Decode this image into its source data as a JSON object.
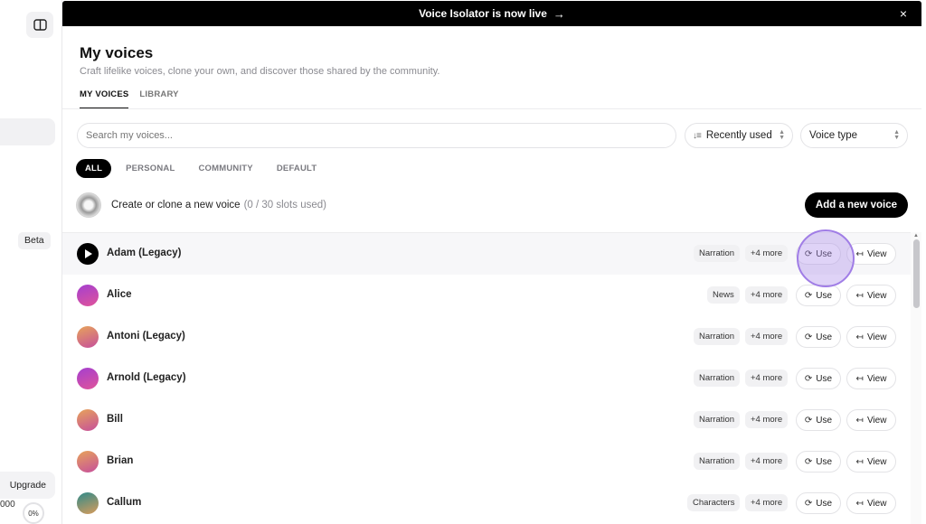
{
  "sidebar": {
    "beta_badge": "Beta",
    "upgrade_label": "Upgrade",
    "credits_text": "000",
    "usage_percent": "0%"
  },
  "banner": {
    "text": "Voice Isolator is now live",
    "arrow": "→",
    "close": "×"
  },
  "header": {
    "title": "My voices",
    "subtitle": "Craft lifelike voices, clone your own, and discover those shared by the community."
  },
  "tabs": [
    {
      "label": "MY VOICES",
      "active": true
    },
    {
      "label": "LIBRARY",
      "active": false
    }
  ],
  "search": {
    "placeholder": "Search my voices..."
  },
  "sort": {
    "value": "Recently used"
  },
  "voice_type": {
    "value": "Voice type"
  },
  "filters": [
    {
      "label": "ALL",
      "active": true
    },
    {
      "label": "PERSONAL",
      "active": false
    },
    {
      "label": "COMMUNITY",
      "active": false
    },
    {
      "label": "DEFAULT",
      "active": false
    }
  ],
  "create": {
    "label": "Create or clone a new voice",
    "slots": "(0 / 30 slots used)",
    "button": "Add a new voice"
  },
  "row_buttons": {
    "use": "Use",
    "view": "View"
  },
  "voices": [
    {
      "name": "Adam (Legacy)",
      "tag": "Narration",
      "more": "+4 more",
      "playing": true,
      "colors": [
        "#000000",
        "#000000"
      ]
    },
    {
      "name": "Alice",
      "tag": "News",
      "more": "+4 more",
      "playing": false,
      "colors": [
        "#a43fd0",
        "#e0549a"
      ]
    },
    {
      "name": "Antoni (Legacy)",
      "tag": "Narration",
      "more": "+4 more",
      "playing": false,
      "colors": [
        "#e7a45a",
        "#c64f9b"
      ]
    },
    {
      "name": "Arnold (Legacy)",
      "tag": "Narration",
      "more": "+4 more",
      "playing": false,
      "colors": [
        "#a43fd0",
        "#e0549a"
      ]
    },
    {
      "name": "Bill",
      "tag": "Narration",
      "more": "+4 more",
      "playing": false,
      "colors": [
        "#e7a45a",
        "#c64f9b"
      ]
    },
    {
      "name": "Brian",
      "tag": "Narration",
      "more": "+4 more",
      "playing": false,
      "colors": [
        "#e7a45a",
        "#c64f9b"
      ]
    },
    {
      "name": "Callum",
      "tag": "Characters",
      "more": "+4 more",
      "playing": false,
      "colors": [
        "#2f8a8a",
        "#d89c5b"
      ]
    }
  ]
}
